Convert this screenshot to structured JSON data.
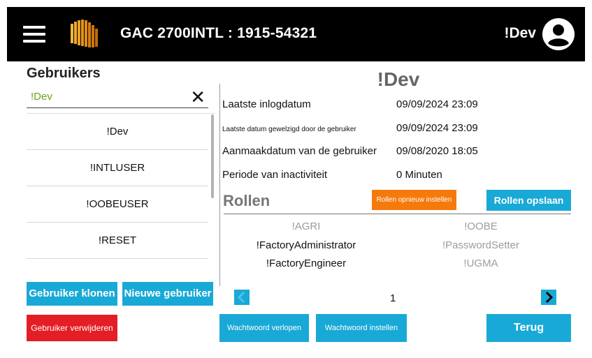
{
  "header": {
    "title": "GAC 2700INTL : 1915-54321",
    "user": "!Dev",
    "menu_icon": "hamburger-menu-icon",
    "logo_icon": "gac-logo-icon",
    "account_icon": "account-circle-icon"
  },
  "users_panel": {
    "title": "Gebruikers",
    "search_value": "!Dev",
    "clear_icon": "✕",
    "items": [
      {
        "label": "!Dev"
      },
      {
        "label": "!INTLUSER"
      },
      {
        "label": "!OOBEUSER"
      },
      {
        "label": "!RESET"
      }
    ],
    "clone_button": "Gebruiker klonen",
    "new_button": "Nieuwe gebruiker",
    "delete_button": "Gebruiker verwijderen"
  },
  "detail": {
    "title": "!Dev",
    "fields": [
      {
        "label": "Laatste inlogdatum",
        "value": "09/09/2024 23:09"
      },
      {
        "label": "Laatste datum gewelzigd door de gebruiker",
        "value": "09/09/2024 23:09"
      },
      {
        "label": "Aanmaakdatum van de gebruiker",
        "value": "09/08/2020 18:05"
      },
      {
        "label": "Periode van inactiviteit",
        "value": "0 Minuten"
      }
    ]
  },
  "roles": {
    "title": "Rollen",
    "reset_button": "Rollen opnieuw instellen",
    "save_button": "Rollen opslaan",
    "items": [
      {
        "label": "!AGRI",
        "active": false
      },
      {
        "label": "!OOBE",
        "active": false
      },
      {
        "label": "!FactoryAdministrator",
        "active": true
      },
      {
        "label": "!PasswordSetter",
        "active": false
      },
      {
        "label": "!FactoryEngineer",
        "active": true
      },
      {
        "label": "!UGMA",
        "active": false
      }
    ],
    "page": "1",
    "prev_icon": "chevron-left-icon",
    "next_icon": "chevron-right-icon"
  },
  "footer": {
    "expire_password_button": "Wachtwoord verlopen",
    "set_password_button": "Wachtwoord instellen",
    "back_button": "Terug"
  },
  "colors": {
    "accent_blue": "#19a9d6",
    "danger_red": "#e41e25",
    "warning_orange": "#f57a0c",
    "search_green": "#6aa31c",
    "topbar_black": "#000000"
  }
}
